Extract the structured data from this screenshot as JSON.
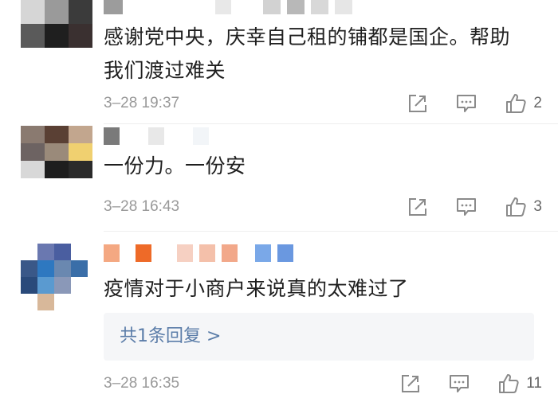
{
  "comments": [
    {
      "text_lines": [
        "感谢党中央，庆幸自己租的铺都是国企。帮助",
        "我们渡过难关"
      ],
      "time": "3–28 19:37",
      "likes": "2"
    },
    {
      "text_lines": [
        "一份力。一份安"
      ],
      "time": "3–28 16:43",
      "likes": "3"
    },
    {
      "text_lines": [
        "疫情对于小商户来说真的太难过了"
      ],
      "time": "3–28 16:35",
      "likes": "11",
      "reply_summary": "共1条回复 >"
    }
  ],
  "icons": {
    "share": "share-icon",
    "comment": "comment-icon",
    "like": "thumbs-up-icon"
  },
  "colors": {
    "meta_gray": "#999999",
    "reply_link": "#5a7ca8",
    "reply_bg": "#f5f6f8"
  }
}
